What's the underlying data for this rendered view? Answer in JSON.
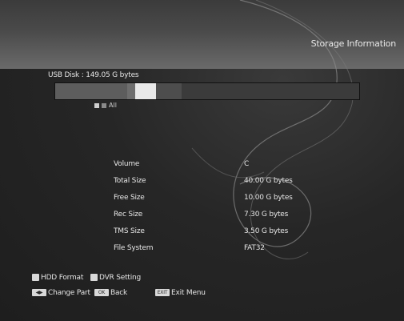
{
  "header": {
    "title": "Storage Information"
  },
  "usb": {
    "label": "USB Disk : 149.05 G bytes"
  },
  "legend": {
    "label": "All"
  },
  "info": {
    "rows": [
      {
        "label": "Volume",
        "value": "C"
      },
      {
        "label": "Total Size",
        "value": "40.00 G bytes"
      },
      {
        "label": "Free Size",
        "value": "10.00 G bytes"
      },
      {
        "label": "Rec Size",
        "value": "7.30 G bytes"
      },
      {
        "label": "TMS Size",
        "value": "3.50 G bytes"
      },
      {
        "label": "File System",
        "value": "FAT32"
      }
    ]
  },
  "footer": {
    "hdd_format": "HDD Format",
    "dvr_setting": "DVR Setting",
    "change_part": "Change Part",
    "back": "Back",
    "exit": "Exit Menu",
    "key_ok": "OK",
    "key_exit": "EXIT",
    "key_arrows": "◀▶"
  },
  "usage": {
    "used_fraction": 0.24,
    "rec_fraction": 0.03,
    "highlight_fraction": 0.07,
    "tms_fraction": 0.08
  },
  "colors": {
    "text": "#e6e6e6",
    "bar_bg": "#3b3b3b",
    "highlight": "#e9e9e9"
  }
}
